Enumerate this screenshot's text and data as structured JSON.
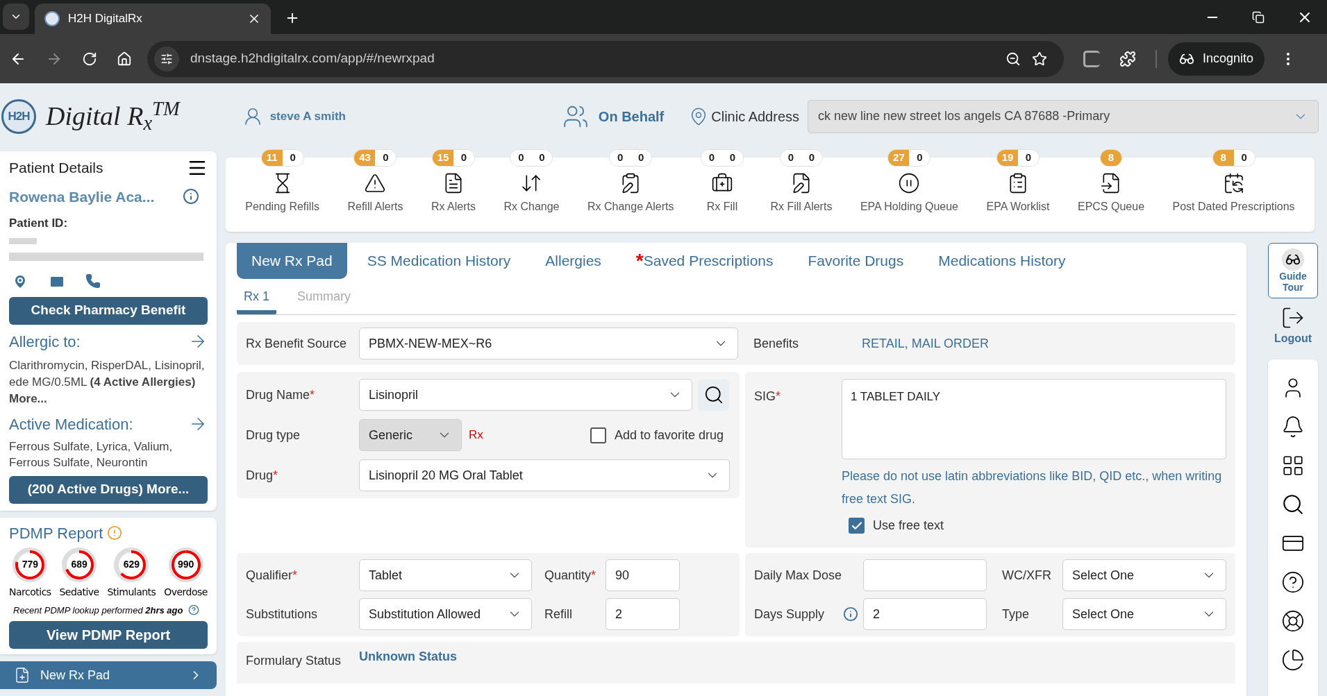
{
  "browser": {
    "tab_title": "H2H DigitalRx",
    "url": "dnstage.h2hdigitalrx.com/app/#/newrxpad",
    "profile": "Incognito"
  },
  "header": {
    "logo_mark": "H2H",
    "logo_text": "Digital R$_{x}$$^{TM}$",
    "user_name": "steve A smith",
    "on_behalf": "On Behalf",
    "clinic_label": "Clinic Address",
    "clinic_address": "ck new line new street los angels CA 87688 -Primary"
  },
  "patient": {
    "title": "Patient Details",
    "name": "Rowena Baylie Aca...",
    "id_label": "Patient ID:",
    "check_button": "Check Pharmacy Benefit",
    "allergies": {
      "title": "Allergic to:",
      "text": "Clarithromycin, RisperDAL, Lisinopril, ede MG/0.5ML **(4 Active Allergies) More...**"
    },
    "medications": {
      "title": "Active Medication:",
      "text": "Ferrous Sulfate, Lyrica, Valium, Ferrous Sulfate, Neurontin",
      "button": "(200 Active Drugs) More..."
    }
  },
  "pdmp": {
    "title": "PDMP Report",
    "gauges": [
      {
        "value": "779",
        "label": "Narcotics",
        "level": 0.78
      },
      {
        "value": "689",
        "label": "Sedative",
        "level": 0.69
      },
      {
        "value": "629",
        "label": "Stimulants",
        "level": 0.63
      },
      {
        "value": "990",
        "label": "Overdose",
        "level": 0.99
      }
    ],
    "note": "Recent PDMP lookup performed **2hrs ago**",
    "button": "View PDMP Report"
  },
  "nav": {
    "label": "New Rx Pad"
  },
  "counters": [
    {
      "label": "Pending Refills",
      "counts": [
        {
          "value": "11",
          "highlighted": true
        },
        {
          "value": "0",
          "highlighted": false
        }
      ]
    },
    {
      "label": "Refill Alerts",
      "counts": [
        {
          "value": "43",
          "highlighted": true
        },
        {
          "value": "0",
          "highlighted": false
        }
      ]
    },
    {
      "label": "Rx Alerts",
      "counts": [
        {
          "value": "15",
          "highlighted": true
        },
        {
          "value": "0",
          "highlighted": false
        }
      ]
    },
    {
      "label": "Rx Change",
      "counts": [
        {
          "value": "0",
          "highlighted": false
        },
        {
          "value": "0",
          "highlighted": false
        }
      ]
    },
    {
      "label": "Rx Change Alerts",
      "counts": [
        {
          "value": "0",
          "highlighted": false
        },
        {
          "value": "0",
          "highlighted": false
        }
      ]
    },
    {
      "label": "Rx Fill",
      "counts": [
        {
          "value": "0",
          "highlighted": false
        },
        {
          "value": "0",
          "highlighted": false
        }
      ]
    },
    {
      "label": "Rx Fill Alerts",
      "counts": [
        {
          "value": "0",
          "highlighted": false
        },
        {
          "value": "0",
          "highlighted": false
        }
      ]
    },
    {
      "label": "EPA Holding Queue",
      "counts": [
        {
          "value": "27",
          "highlighted": true
        },
        {
          "value": "0",
          "highlighted": false
        }
      ]
    },
    {
      "label": "EPA Worklist",
      "counts": [
        {
          "value": "19",
          "highlighted": true
        },
        {
          "value": "0",
          "highlighted": false
        }
      ]
    },
    {
      "label": "EPCS Queue",
      "counts": [
        {
          "value": "8",
          "highlighted": true
        }
      ]
    },
    {
      "label": "Post Dated Prescriptions",
      "counts": [
        {
          "value": "8",
          "highlighted": true
        },
        {
          "value": "0",
          "highlighted": false
        }
      ]
    }
  ],
  "main_tabs": [
    {
      "label": "New Rx Pad",
      "selected": true
    },
    {
      "label": "SS Medication History",
      "selected": false
    },
    {
      "label": "Allergies",
      "selected": false
    },
    {
      "label": "Saved Prescriptions",
      "selected": false,
      "marker": "*"
    },
    {
      "label": "Favorite Drugs",
      "selected": false
    },
    {
      "label": "Medications History",
      "selected": false
    }
  ],
  "sub_tabs": [
    {
      "label": "Rx 1",
      "selected": true
    },
    {
      "label": "Summary",
      "selected": false
    }
  ],
  "form": {
    "benefit_source": {
      "label": "Rx Benefit Source",
      "value": "PBMX-NEW-MEX~R6"
    },
    "benefits": {
      "label": "Benefits",
      "value": "RETAIL, MAIL ORDER"
    },
    "drug_name": {
      "label": "Drug Name",
      "value": "Lisinopril",
      "marker": "*"
    },
    "drug_type": {
      "label": "Drug type",
      "value": "Generic",
      "tag": "Rx"
    },
    "favorite": {
      "label": "Add to favorite drug",
      "checked": false
    },
    "drug": {
      "label": "Drug",
      "value": "Lisinopril 20 MG Oral Tablet",
      "marker": "*"
    },
    "sig": {
      "label": "SIG",
      "value": "1 TABLET DAILY",
      "marker": "*",
      "hint": "Please do not use latin abbreviations like BID, QID etc., when writing free text SIG."
    },
    "free_text": {
      "label": "Use free text",
      "checked": true
    },
    "qualifier": {
      "label": "Qualifier",
      "value": "Tablet",
      "marker": "*"
    },
    "quantity": {
      "label": "Quantity",
      "value": "90",
      "marker": "*"
    },
    "substitutions": {
      "label": "Substitutions",
      "value": "Substitution Allowed"
    },
    "refill": {
      "label": "Refill",
      "value": "2"
    },
    "daily_max_dose": {
      "label": "Daily Max Dose"
    },
    "days_supply": {
      "label": "Days Supply",
      "value": "2"
    },
    "wc_xfr": {
      "label": "WC/XFR",
      "value": "Select One"
    },
    "type": {
      "label": "Type",
      "value": "Select One"
    },
    "formulary": {
      "label": "Formulary Status",
      "value": "Unknown Status"
    }
  },
  "rail": {
    "guide": "Guide Tour",
    "logout": "Logout"
  }
}
